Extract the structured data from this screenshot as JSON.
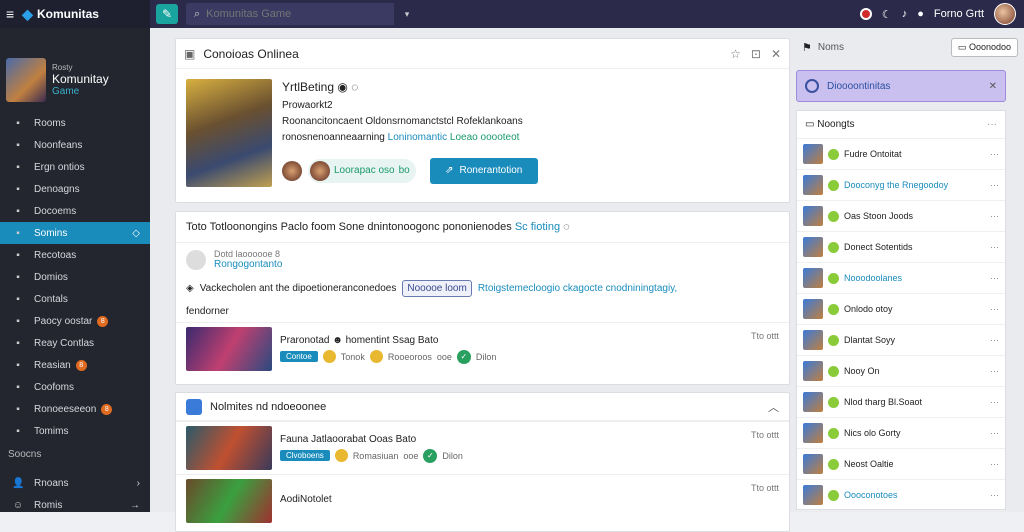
{
  "topbar": {
    "app_name": "Komunitas",
    "search_placeholder": "Komunitas Game",
    "user_name": "Forno Grtt"
  },
  "community": {
    "label": "Rosty",
    "name": "Komunitay",
    "sub": "Game"
  },
  "nav": [
    {
      "label": "Rooms",
      "icon": "card-icon"
    },
    {
      "label": "Noonfeans",
      "icon": "doc-icon"
    },
    {
      "label": "Ergn ontios",
      "icon": "chat-icon"
    },
    {
      "label": "Denoagns",
      "icon": "grid-icon"
    },
    {
      "label": "Docoems",
      "icon": "folder-icon"
    },
    {
      "label": "Somins",
      "icon": "settings-icon",
      "active": true
    },
    {
      "label": "Recotoas",
      "icon": "list-icon"
    },
    {
      "label": "Domios",
      "icon": "people-icon"
    },
    {
      "label": "Contals",
      "icon": "contacts-icon"
    },
    {
      "label": "Paocy oostar",
      "icon": "brush-icon",
      "badge": "8"
    },
    {
      "label": "Reay Contlas",
      "icon": "calendar-icon"
    },
    {
      "label": "Reasian",
      "icon": "music-icon",
      "badge": "8"
    },
    {
      "label": "Coofoms",
      "icon": "gear-icon"
    },
    {
      "label": "Ronoeeseeon",
      "icon": "note-icon",
      "badge": "8"
    },
    {
      "label": "Tomims",
      "icon": "chat2-icon"
    }
  ],
  "sources": {
    "title": "Soocns",
    "items": [
      {
        "label": "Rnoans"
      },
      {
        "label": "Romis"
      }
    ]
  },
  "card1": {
    "title": "Conoioas Onlinea",
    "player": "YrtlBeting",
    "level": "Prowaorkt2",
    "desc1": "Roonancitoncaent Oldonsrnomanctstcl Rofeklankoans",
    "desc2": "ronosnenoanneaarning",
    "desc2b": "Loninomantic",
    "desc2c": "Loeao ooooteot",
    "pill_text": "Loorapac oso",
    "pill_badge": "bo",
    "cta": "Ronerantotion"
  },
  "card2": {
    "title": "Toto Totloonongins Paclo foom Sone dnintonoogonc pononienodes",
    "title_teal": "Sc fioting",
    "ans1": "Dotd laoooooe 8",
    "ans2": "Rongogontanto",
    "line1": "Vackecholen ant the dipoetioneranconedoes",
    "tag": "Nooooe loom",
    "line1b": "Rtoigstemecloogio ckagocte cnodniningtagiy,",
    "line2": "fendorner",
    "media": {
      "title": "Praronotad",
      "title2": "homentint Ssag Bato",
      "label": "Contoe",
      "r1": "Tonok",
      "r2": "Rooeoroos",
      "r3": "ooe",
      "r4": "Dilon",
      "time": "Tto ottt"
    }
  },
  "card3": {
    "title": "Nolmites nd ndoeoonee",
    "media1": {
      "title": "Fauna Jatlaoorabat Ooas Bato",
      "label": "Clvoboens",
      "r2": "Romasiuan",
      "r3": "ooe",
      "r4": "Dilon",
      "time": "Tto ottt"
    },
    "media2": {
      "title": "AodiNotolet",
      "time": "Tto ottt"
    }
  },
  "right": {
    "title": "Noms",
    "btn": "Ooonodoo",
    "banner": "Dioooontinitas",
    "list_title": "Noongts",
    "rows": [
      {
        "name": "Fudre Ontoitat"
      },
      {
        "name": "Dooconyg the Rnegoodoy",
        "teal": true
      },
      {
        "name": "Oas Stoon Joods"
      },
      {
        "name": "Donect Sotentids"
      },
      {
        "name": "Nooodoolanes",
        "teal": true
      },
      {
        "name": "Onlodo otoy"
      },
      {
        "name": "Dlantat Soyy"
      },
      {
        "name": "Nooy On"
      },
      {
        "name": "Nlod tharg Bl.Soaot"
      },
      {
        "name": "Nics olo Gorty"
      },
      {
        "name": "Neost Oaltie"
      },
      {
        "name": "Oooconotoes",
        "teal": true
      }
    ]
  }
}
